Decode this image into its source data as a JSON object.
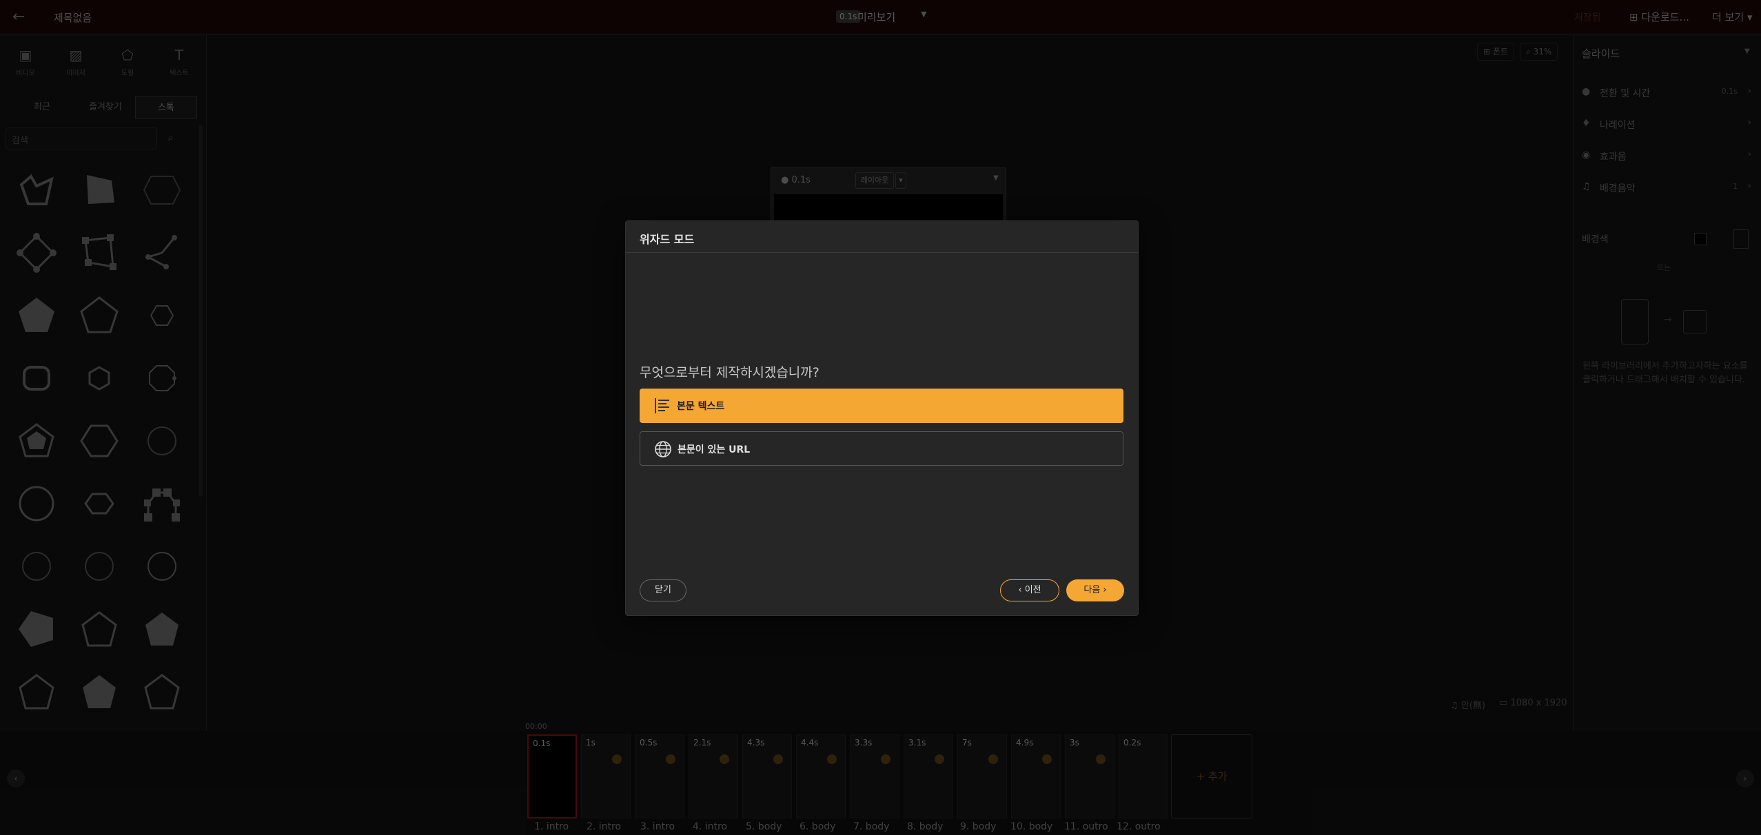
{
  "topbar": {
    "back_icon": "arrow-left-icon",
    "title": "제목없음",
    "time_chip": "0.1s",
    "preview_label": "미리보기",
    "right_text": "저장됨",
    "download_label": "다운로드...",
    "more_label": "더 보기"
  },
  "left_panel": {
    "tools": [
      {
        "icon": "video-icon",
        "label": "비디오"
      },
      {
        "icon": "image-icon",
        "label": "이미지"
      },
      {
        "icon": "shape-icon",
        "label": "도형"
      },
      {
        "icon": "text-icon",
        "label": "텍스트"
      }
    ],
    "tabs": [
      "최근",
      "즐겨찾기",
      "스톡"
    ],
    "search_placeholder": "검색"
  },
  "stage": {
    "time": "0.1s",
    "layout_btn": "레이아웃",
    "font_btn": "폰트",
    "zoom": "31%",
    "music_label": "안(無)",
    "resolution": "1080 x 1920"
  },
  "right_panel": {
    "title": "슬라이드",
    "rows": [
      {
        "icon": "clock-icon",
        "label": "전환 및 시간",
        "value": "0.1s"
      },
      {
        "icon": "mic-icon",
        "label": "나레이션",
        "value": ""
      },
      {
        "icon": "sound-icon",
        "label": "효과음",
        "value": ""
      },
      {
        "icon": "music-icon",
        "label": "배경음악",
        "value": "1"
      }
    ],
    "bg_label": "배경색",
    "help_text": "왼쪽 라이브러리에서 추가하고자하는 요소를 클릭하거나 드래그해서 배치할 수 있습니다."
  },
  "timeline": {
    "start": "00:00",
    "add_label": "+ 추가",
    "clips": [
      {
        "time": "0.1s",
        "label": "1. intro"
      },
      {
        "time": "1s",
        "label": "2. intro"
      },
      {
        "time": "0.5s",
        "label": "3. intro"
      },
      {
        "time": "2.1s",
        "label": "4. intro"
      },
      {
        "time": "4.3s",
        "label": "5. body"
      },
      {
        "time": "4.4s",
        "label": "6. body"
      },
      {
        "time": "3.3s",
        "label": "7. body"
      },
      {
        "time": "3.1s",
        "label": "8. body"
      },
      {
        "time": "7s",
        "label": "9. body"
      },
      {
        "time": "4.9s",
        "label": "10. body"
      },
      {
        "time": "3s",
        "label": "11. outro"
      },
      {
        "time": "0.2s",
        "label": "12. outro"
      }
    ]
  },
  "modal": {
    "title": "위자드 모드",
    "question": "무엇으로부터 제작하시겠습니까?",
    "options": [
      {
        "icon": "text-align-icon",
        "label": "본문 텍스트",
        "selected": true
      },
      {
        "icon": "globe-icon",
        "label": "본문이 있는 URL",
        "selected": false
      }
    ],
    "close_label": "닫기",
    "prev_label": "이전",
    "next_label": "다음",
    "accent_color": "#f5a733"
  }
}
